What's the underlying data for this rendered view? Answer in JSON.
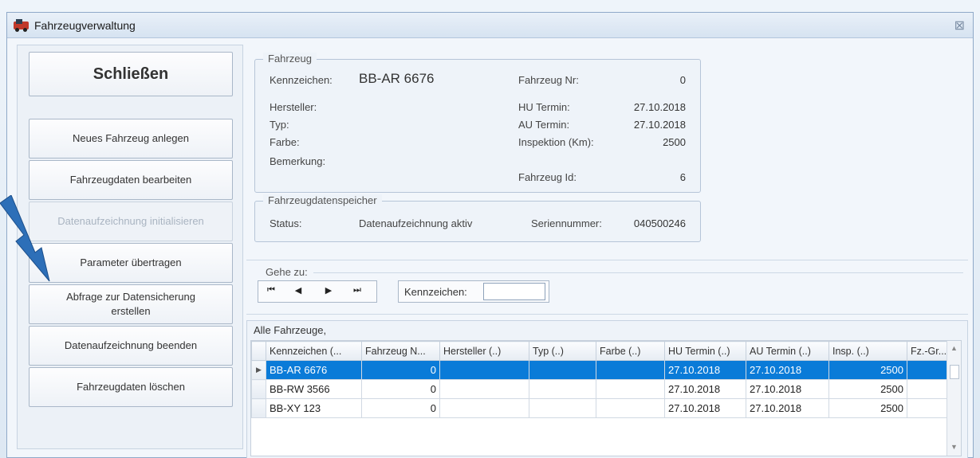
{
  "window": {
    "title": "Fahrzeugverwaltung",
    "close_glyph": "⊠"
  },
  "left_buttons": {
    "close": "Schließen",
    "new_vehicle": "Neues Fahrzeug anlegen",
    "edit_vehicle": "Fahrzeugdaten bearbeiten",
    "init_recording": "Datenaufzeichnung initialisieren",
    "transfer_params": "Parameter übertragen",
    "backup_query_line1": "Abfrage zur Datensicherung",
    "backup_query_line2": "erstellen",
    "end_recording": "Datenaufzeichnung beenden",
    "delete_vehicle": "Fahrzeugdaten löschen"
  },
  "vehicle": {
    "group_title": "Fahrzeug",
    "plate_label": "Kennzeichen:",
    "plate_value": "BB-AR 6676",
    "manufacturer_label": "Hersteller:",
    "type_label": "Typ:",
    "color_label": "Farbe:",
    "remark_label": "Bemerkung:",
    "number_label": "Fahrzeug Nr:",
    "number_value": "0",
    "hu_label": "HU Termin:",
    "hu_value": "27.10.2018",
    "au_label": "AU Termin:",
    "au_value": "27.10.2018",
    "inspection_label": "Inspektion (Km):",
    "inspection_value": "2500",
    "id_label": "Fahrzeug Id:",
    "id_value": "6"
  },
  "storage": {
    "group_title": "Fahrzeugdatenspeicher",
    "status_label": "Status:",
    "status_value": "Datenaufzeichnung aktiv",
    "serial_label": "Seriennummer:",
    "serial_value": "040500246"
  },
  "goto": {
    "group_title": "Gehe zu:",
    "first": "⏮",
    "prev": "◀",
    "next": "▶",
    "last": "⏭",
    "plate_label": "Kennzeichen:",
    "plate_value": ""
  },
  "table": {
    "caption": "Alle Fahrzeuge,",
    "columns": [
      "Kennzeichen (...",
      "Fahrzeug N...",
      "Hersteller (..)",
      "Typ (..)",
      "Farbe (..)",
      "HU Termin (..)",
      "AU Termin (..)",
      "Insp. (..)",
      "Fz.-Gr..."
    ],
    "rows": [
      {
        "selected": true,
        "plate": "BB-AR 6676",
        "number": "0",
        "manufacturer": "",
        "type": "",
        "color": "",
        "hu": "27.10.2018",
        "au": "27.10.2018",
        "insp": "2500",
        "group": ""
      },
      {
        "selected": false,
        "plate": "BB-RW 3566",
        "number": "0",
        "manufacturer": "",
        "type": "",
        "color": "",
        "hu": "27.10.2018",
        "au": "27.10.2018",
        "insp": "2500",
        "group": ""
      },
      {
        "selected": false,
        "plate": "BB-XY 123",
        "number": "0",
        "manufacturer": "",
        "type": "",
        "color": "",
        "hu": "27.10.2018",
        "au": "27.10.2018",
        "insp": "2500",
        "group": ""
      }
    ]
  },
  "colors": {
    "selection": "#0a7bd8",
    "arrow": "#2d6fb8"
  }
}
